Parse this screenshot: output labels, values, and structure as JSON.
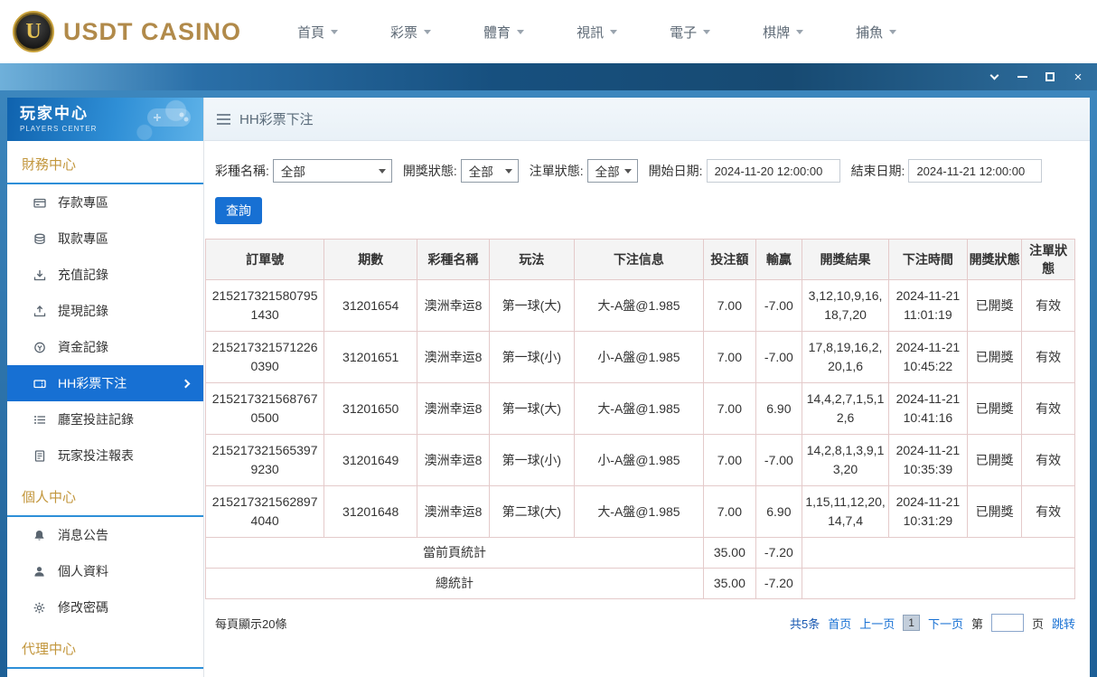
{
  "top_nav": {
    "logo_badge": "U",
    "logo_text": "USDT CASINO",
    "items": [
      "首頁",
      "彩票",
      "體育",
      "視訊",
      "電子",
      "棋牌",
      "捕魚"
    ]
  },
  "window_controls": {
    "close": "×"
  },
  "icons": {
    "menu_icon": "hamburger-bars",
    "collapse_icon": "chevron-down",
    "minimize_icon": "horizontal-bar",
    "maximize_icon": "square-outline",
    "close_icon": "×"
  },
  "sidebar": {
    "title": "玩家中心",
    "subtitle": "PLAYERS CENTER",
    "sections": [
      "財務中心",
      "個人中心",
      "代理中心"
    ],
    "finance_items": [
      "存款專區",
      "取款專區",
      "充值記錄",
      "提現記錄",
      "資金記錄",
      "HH彩票下注",
      "廳室投註記錄",
      "玩家投注報表"
    ],
    "personal_items": [
      "消息公告",
      "個人資料",
      "修改密碼"
    ]
  },
  "main": {
    "breadcrumb": "HH彩票下注",
    "filters": {
      "lottery_label": "彩種名稱:",
      "lottery_value": "全部",
      "draw_status_label": "開獎狀態:",
      "draw_status_value": "全部",
      "order_status_label": "注單狀態:",
      "order_status_value": "全部",
      "start_label": "開始日期:",
      "start_value": "2024-11-20 12:00:00",
      "end_label": "結束日期:",
      "end_value": "2024-11-21 12:00:00",
      "query_button": "查詢"
    },
    "table": {
      "headers": [
        "訂單號",
        "期數",
        "彩種名稱",
        "玩法",
        "下注信息",
        "投注額",
        "輸贏",
        "開獎結果",
        "下注時間",
        "開獎狀態",
        "注單狀態"
      ],
      "rows": [
        [
          "2152173215807951430",
          "31201654",
          "澳洲幸运8",
          "第一球(大)",
          "大-A盤@1.985",
          "7.00",
          "-7.00",
          "3,12,10,9,16,18,7,20",
          "2024-11-21 11:01:19",
          "已開獎",
          "有效"
        ],
        [
          "2152173215712260390",
          "31201651",
          "澳洲幸运8",
          "第一球(小)",
          "小-A盤@1.985",
          "7.00",
          "-7.00",
          "17,8,19,16,2,20,1,6",
          "2024-11-21 10:45:22",
          "已開獎",
          "有效"
        ],
        [
          "2152173215687670500",
          "31201650",
          "澳洲幸运8",
          "第一球(大)",
          "大-A盤@1.985",
          "7.00",
          "6.90",
          "14,4,2,7,1,5,12,6",
          "2024-11-21 10:41:16",
          "已開獎",
          "有效"
        ],
        [
          "2152173215653979230",
          "31201649",
          "澳洲幸运8",
          "第一球(小)",
          "小-A盤@1.985",
          "7.00",
          "-7.00",
          "14,2,8,1,3,9,13,20",
          "2024-11-21 10:35:39",
          "已開獎",
          "有效"
        ],
        [
          "2152173215628974040",
          "31201648",
          "澳洲幸运8",
          "第二球(大)",
          "大-A盤@1.985",
          "7.00",
          "6.90",
          "1,15,11,12,20,14,7,4",
          "2024-11-21 10:31:29",
          "已開獎",
          "有效"
        ]
      ],
      "page_summary": {
        "label": "當前頁統計",
        "bet": "35.00",
        "winloss": "-7.20"
      },
      "total_summary": {
        "label": "總統計",
        "bet": "35.00",
        "winloss": "-7.20"
      }
    },
    "pagination": {
      "page_size_text": "每頁顯示20條",
      "total_text": "共5条",
      "first_label": "首页",
      "prev_label": "上一页",
      "current_page": "1",
      "next_label": "下一页",
      "jump_prefix": "第",
      "jump_suffix": "页",
      "jump_label": "跳转"
    }
  }
}
